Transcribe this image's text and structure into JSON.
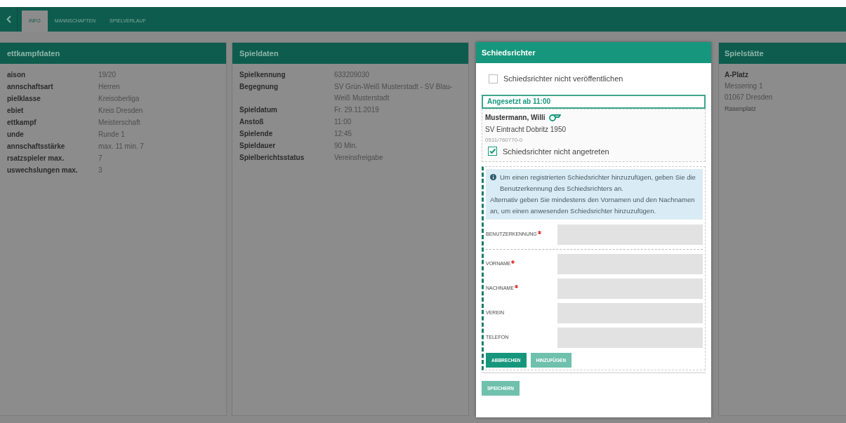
{
  "tabs": [
    {
      "label": "INFO",
      "selected": true
    },
    {
      "label": "MANNSCHAFTEN",
      "selected": false
    },
    {
      "label": "SPIELVERLAUF",
      "selected": false
    }
  ],
  "panels": [
    {
      "title": "ettkampfdaten",
      "rows": [
        {
          "label": "aison",
          "value": "19/20"
        },
        {
          "label": "annschaftsart",
          "value": "Herren"
        },
        {
          "label": "pielklasse",
          "value": "Kreisoberliga"
        },
        {
          "label": "ebiet",
          "value": "Kreis Dresden"
        },
        {
          "label": "ettkampf",
          "value": "Meisterschaft"
        },
        {
          "label": "unde",
          "value": "Runde 1"
        },
        {
          "label": "annschaftsstärke",
          "value": "max. 11 min. 7"
        },
        {
          "label": "rsatzspieler max.",
          "value": "7"
        },
        {
          "label": "uswechslungen max.",
          "value": "3"
        }
      ]
    },
    {
      "title": "Spieldaten",
      "rows": [
        {
          "label": "Spielkennung",
          "value": "633209030"
        },
        {
          "label": "Begegnung",
          "value": "SV Grün-Weiß Musterstadt - SV Blau-Weiß Musterstadt"
        },
        {
          "label": "Spieldatum",
          "value": "Fr. 29.11.2019"
        },
        {
          "label": "Anstoß",
          "value": "11:00"
        },
        {
          "label": "Spielende",
          "value": "12:45"
        },
        {
          "label": "Spieldauer",
          "value": "90  Min."
        },
        {
          "label": "Spielberichtsstatus",
          "value": "Vereinsfreigabe"
        }
      ]
    }
  ],
  "referee": {
    "title": "Schiedsrichter",
    "hide_checkbox": {
      "label": "Schiedsrichter nicht veröffentlichen",
      "checked": false
    },
    "assigned_header": "Angesetzt ab 11:00",
    "name": "Mustermann, Willi",
    "club": "SV Eintracht Dobritz 1950",
    "phone": "0511/760770-0",
    "absent_checkbox": {
      "label": "Schiedsrichter nicht angetreten",
      "checked": true
    },
    "info": [
      "Um einen registrierten Schiedsrichter hinzuzufügen, geben Sie die Benutzerkennung des Schiedsrichters an.",
      "Alternativ geben Sie mindestens den Vornamen und den Nachnamen an, um einen anwesenden Schiedsrichter hinzuzufügen."
    ],
    "fields": [
      {
        "label": "BENUTZERKENNUNG",
        "required": true
      },
      {
        "label": "VORNAME",
        "required": true
      },
      {
        "label": "NACHNAME",
        "required": true
      },
      {
        "label": "VEREIN",
        "required": false
      },
      {
        "label": "TELEFON",
        "required": false
      }
    ],
    "buttons": [
      {
        "label": "ABBRECHEN",
        "disabled": false
      },
      {
        "label": "HINZUFÜGEN",
        "disabled": true
      }
    ],
    "save_button": {
      "label": "SPEICHERN",
      "disabled": true
    }
  },
  "venue": {
    "title": "Spielstätte",
    "name": "A-Platz",
    "street": "Messering 1",
    "city": "01067 Dresden",
    "surface": "Rasenplatz"
  }
}
